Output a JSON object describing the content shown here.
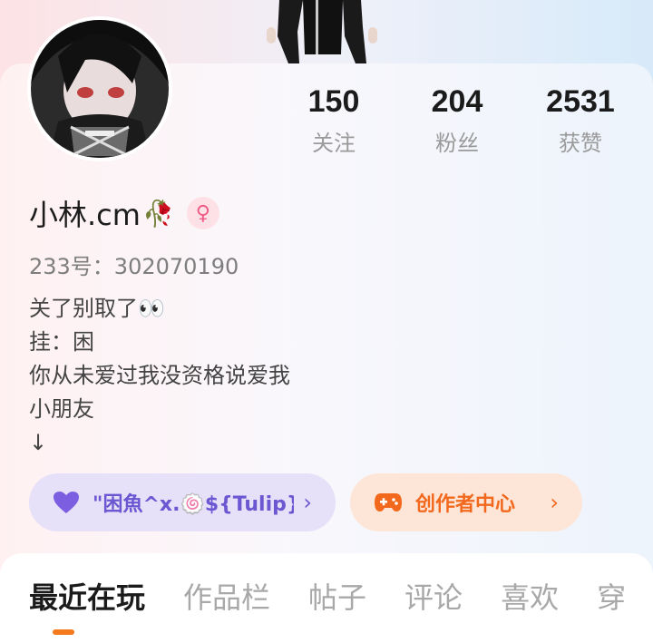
{
  "profile": {
    "name": "小林.cm",
    "name_emoji": "🥀",
    "gender_symbol": "♀",
    "uid": "233号：302070190"
  },
  "stats": [
    {
      "value": "150",
      "label": "关注"
    },
    {
      "value": "204",
      "label": "粉丝"
    },
    {
      "value": "2531",
      "label": "获赞"
    }
  ],
  "bio": [
    "关了别取了👀",
    "挂：困",
    "你从未爱过我没资格说爱我",
    "小朋友",
    "↓"
  ],
  "chips": {
    "group_label": "\"困魚^x.🍥${Tulip}",
    "creator_label": "创作者中心",
    "arrow": "›"
  },
  "tabs": [
    "最近在玩",
    "作品栏",
    "帖子",
    "评论",
    "喜欢",
    "穿"
  ],
  "colors": {
    "accent_orange": "#f57a1e",
    "accent_purple": "#6a57d1",
    "gender_pink": "#ef5a86"
  },
  "icons": {
    "heart": "purple-heart-icon",
    "gamepad": "gamepad-icon",
    "gender": "female-symbol-icon"
  }
}
